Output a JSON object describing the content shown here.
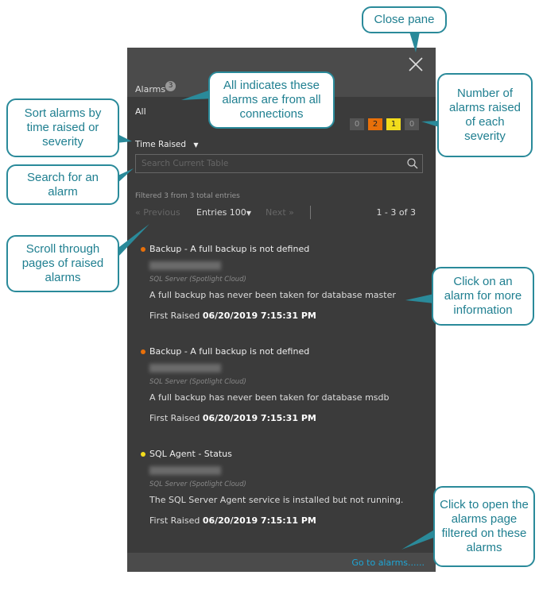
{
  "panel": {
    "title": "Alarms",
    "alarm_count": "3",
    "scope": "All",
    "severity_counts": [
      {
        "value": "0",
        "color": "#555555",
        "text": "#999999"
      },
      {
        "value": "2",
        "color": "#e8700a",
        "text": "#222222"
      },
      {
        "value": "1",
        "color": "#f2dc1c",
        "text": "#222222"
      },
      {
        "value": "0",
        "color": "#555555",
        "text": "#999999"
      }
    ],
    "sort_label": "Time Raised",
    "search_placeholder": "Search Current Table",
    "filter_text": "Filtered 3 from 3 total entries",
    "pager": {
      "previous": "Previous",
      "entries": "Entries 100",
      "next": "Next",
      "range": "1 - 3 of 3"
    },
    "alarms": [
      {
        "title": "Backup - A full backup is not defined",
        "severity_color": "#e8700a",
        "source": "SQL Server (Spotlight Cloud)",
        "description": "A full backup has never been taken for database master",
        "first_raised_label": "First Raised",
        "first_raised": "06/20/2019 7:15:31 PM"
      },
      {
        "title": "Backup - A full backup is not defined",
        "severity_color": "#e8700a",
        "source": "SQL Server (Spotlight Cloud)",
        "description": "A full backup has never been taken for database msdb",
        "first_raised_label": "First Raised",
        "first_raised": "06/20/2019 7:15:31 PM"
      },
      {
        "title": "SQL Agent - Status",
        "severity_color": "#f2dc1c",
        "source": "SQL Server (Spotlight Cloud)",
        "description": "The SQL Server Agent service is installed but not running.",
        "first_raised_label": "First Raised",
        "first_raised": "06/20/2019 7:15:11 PM"
      }
    ],
    "go_to": "Go to alarms......"
  },
  "callouts": {
    "close": "Close pane",
    "all": "All indicates these alarms are from all connections",
    "number": "Number of alarms raised of each severity",
    "sort": "Sort alarms by time raised or severity",
    "search": "Search for an alarm",
    "scroll": "Scroll through pages of raised alarms",
    "click": "Click on an alarm for more information",
    "open": "Click to open the alarms page filtered on these alarms"
  }
}
